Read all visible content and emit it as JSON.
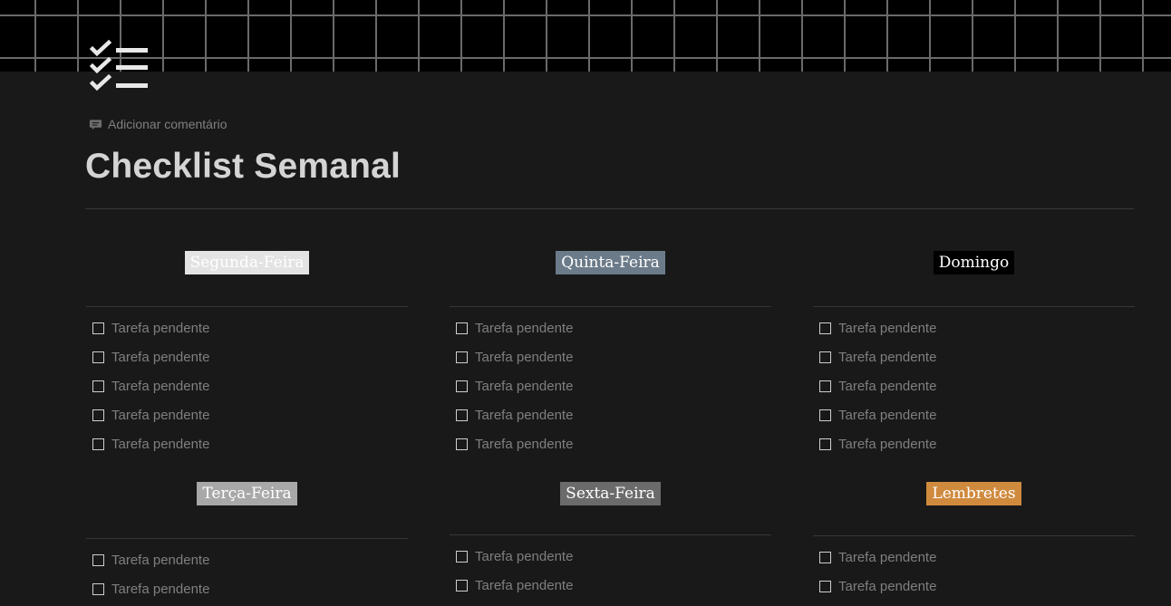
{
  "page": {
    "comment_label": "Adicionar comentário",
    "title": "Checklist Semanal",
    "icon": "checklist-icon"
  },
  "columns": [
    {
      "day": "Segunda-Feira",
      "tag_color": "#e3e3e3",
      "tag_text_color": "#ffffff",
      "tasks": [
        "Tarefa pendente",
        "Tarefa pendente",
        "Tarefa pendente",
        "Tarefa pendente",
        "Tarefa pendente"
      ]
    },
    {
      "day": "Quinta-Feira",
      "tag_color": "#6b7b8a",
      "tag_text_color": "#ffffff",
      "tasks": [
        "Tarefa pendente",
        "Tarefa pendente",
        "Tarefa pendente",
        "Tarefa pendente",
        "Tarefa pendente"
      ]
    },
    {
      "day": "Domingo",
      "tag_color": "#000000",
      "tag_text_color": "#ffffff",
      "tasks": [
        "Tarefa pendente",
        "Tarefa pendente",
        "Tarefa pendente",
        "Tarefa pendente",
        "Tarefa pendente"
      ]
    },
    {
      "day": "Terça-Feira",
      "tag_color": "#a8a8a8",
      "tag_text_color": "#ffffff",
      "tasks": [
        "Tarefa pendente",
        "Tarefa pendente"
      ]
    },
    {
      "day": "Sexta-Feira",
      "tag_color": "#6b6b6b",
      "tag_text_color": "#ffffff",
      "tasks": [
        "Tarefa pendente",
        "Tarefa pendente"
      ]
    },
    {
      "day": "Lembretes",
      "tag_color": "#d08a3e",
      "tag_text_color": "#ffffff",
      "tasks": [
        "Tarefa pendente",
        "Tarefa pendente"
      ]
    }
  ]
}
